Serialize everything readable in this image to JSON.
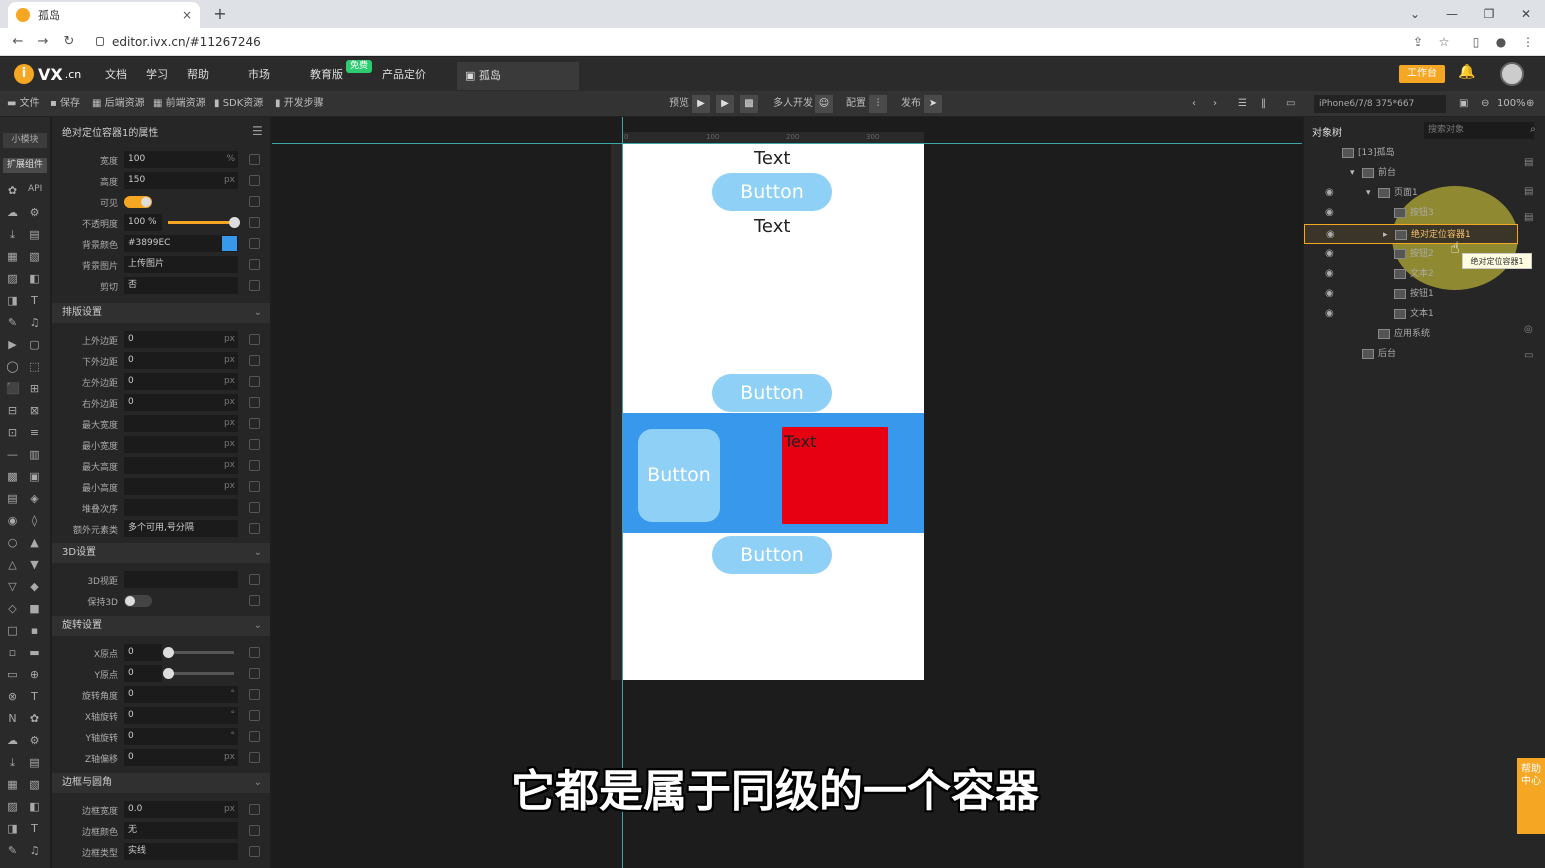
{
  "browser": {
    "tab_title": "孤岛",
    "tab_close": "×",
    "new_tab": "+",
    "url": "editor.ivx.cn/#11267246",
    "win_min": "—",
    "win_restore": "❐",
    "win_close": "✕",
    "win_chevron": "⌄"
  },
  "app": {
    "logo_text": "VX",
    "logo_suffix": ".cn",
    "menu": [
      "文档",
      "学习",
      "帮助",
      "市场",
      "教育版",
      "产品定价"
    ],
    "free_badge": "免费",
    "project_tab": "孤岛",
    "work_button": "工作台"
  },
  "toolbar": {
    "items": [
      "文件",
      "保存",
      "后端资源",
      "前端资源",
      "SDK资源",
      "开发步骤"
    ],
    "preview": "预览",
    "multi_dev": "多人开发",
    "config": "配置",
    "publish": "发布",
    "device": "iPhone6/7/8 375*667",
    "zoom": "100%"
  },
  "leftstrip": {
    "small_component": "小模块",
    "ext_component": "扩展组件",
    "api": "API"
  },
  "properties": {
    "title": "绝对定位容器1的属性",
    "fields": [
      {
        "label": "宽度",
        "value": "100",
        "unit": "%"
      },
      {
        "label": "高度",
        "value": "150",
        "unit": "px"
      },
      {
        "label": "可见",
        "value": "",
        "unit": ""
      },
      {
        "label": "不透明度",
        "value": "100 %",
        "unit": ""
      },
      {
        "label": "背景颜色",
        "value": "#3899EC",
        "unit": ""
      },
      {
        "label": "背景图片",
        "value": "上传图片",
        "unit": ""
      },
      {
        "label": "剪切",
        "value": "否",
        "unit": ""
      }
    ],
    "layout_section": "排版设置",
    "layout_fields": [
      {
        "label": "上外边距",
        "value": "0",
        "unit": "px"
      },
      {
        "label": "下外边距",
        "value": "0",
        "unit": "px"
      },
      {
        "label": "左外边距",
        "value": "0",
        "unit": "px"
      },
      {
        "label": "右外边距",
        "value": "0",
        "unit": "px"
      },
      {
        "label": "最大宽度",
        "value": "",
        "unit": "px"
      },
      {
        "label": "最小宽度",
        "value": "",
        "unit": "px"
      },
      {
        "label": "最大高度",
        "value": "",
        "unit": "px"
      },
      {
        "label": "最小高度",
        "value": "",
        "unit": "px"
      },
      {
        "label": "堆叠次序",
        "value": "",
        "unit": ""
      },
      {
        "label": "额外元素类",
        "value": "多个可用,号分隔",
        "unit": ""
      }
    ],
    "section_3d": "3D设置",
    "fields_3d": [
      {
        "label": "3D视距",
        "value": "",
        "unit": ""
      },
      {
        "label": "保持3D",
        "value": "",
        "unit": ""
      }
    ],
    "rotate_section": "旋转设置",
    "rotate_fields": [
      {
        "label": "X原点",
        "value": "0",
        "unit": "%"
      },
      {
        "label": "Y原点",
        "value": "0",
        "unit": "%"
      },
      {
        "label": "旋转角度",
        "value": "0",
        "unit": "°"
      },
      {
        "label": "X轴旋转",
        "value": "0",
        "unit": "°"
      },
      {
        "label": "Y轴旋转",
        "value": "0",
        "unit": "°"
      },
      {
        "label": "Z轴偏移",
        "value": "0",
        "unit": "px"
      }
    ],
    "border_section": "边框与圆角",
    "border_fields": [
      {
        "label": "边框宽度",
        "value": "0.0",
        "unit": "px"
      },
      {
        "label": "边框颜色",
        "value": "无",
        "unit": ""
      },
      {
        "label": "边框类型",
        "value": "实线",
        "unit": ""
      }
    ],
    "opacity_fraction": 1.0,
    "bg_color": "#3899EC"
  },
  "canvas": {
    "ruler_ticks": [
      "0",
      "100",
      "200",
      "300"
    ],
    "text1": "Text",
    "button1": "Button",
    "text2": "Text",
    "button2": "Button",
    "container_button": "Button",
    "container_text": "Text",
    "button3": "Button",
    "container_color": "#3899EC",
    "red_color": "#E60012"
  },
  "subtitle": "它都是属于同级的一个容器",
  "tree": {
    "title": "对象树",
    "search_placeholder": "搜索对象",
    "rows": [
      {
        "label": "[13]孤岛"
      },
      {
        "label": "前台"
      },
      {
        "label": "页面1"
      },
      {
        "label": "按钮3"
      },
      {
        "label": "绝对定位容器1"
      },
      {
        "label": "按钮2"
      },
      {
        "label": "文本2"
      },
      {
        "label": "按钮1"
      },
      {
        "label": "文本1"
      },
      {
        "label": "应用系统"
      },
      {
        "label": "后台"
      }
    ],
    "tooltip": "绝对定位容器1"
  },
  "help_tab": "帮助中心"
}
